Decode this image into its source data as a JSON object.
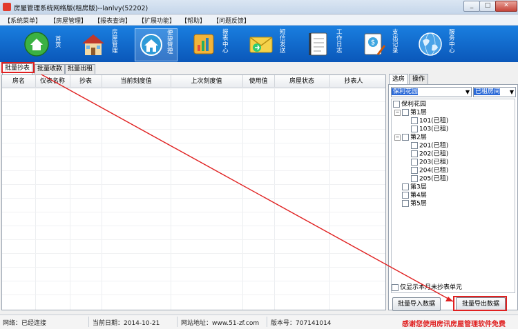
{
  "window": {
    "title": "房屋管理系统网络版(租房版)--lanlvy(52202)"
  },
  "menu": [
    "【系统菜单】",
    "【房屋管理】",
    "【报表查询】",
    "【扩展功能】",
    "【帮助】",
    "【问题反馈】"
  ],
  "toolbar": [
    {
      "label": "首页",
      "icon": "home-icon"
    },
    {
      "label": "房屋管理",
      "icon": "house-icon"
    },
    {
      "label": "便捷管理",
      "icon": "house-gear-icon"
    },
    {
      "label": "报表中心",
      "icon": "chart-book-icon"
    },
    {
      "label": "短信发送",
      "icon": "envelope-icon"
    },
    {
      "label": "工作日志",
      "icon": "notebook-icon"
    },
    {
      "label": "支出记录",
      "icon": "money-note-icon"
    },
    {
      "label": "服务中心",
      "icon": "globe-icon"
    }
  ],
  "tabs": [
    "批量抄表",
    "批量收款",
    "批量出租"
  ],
  "grid": {
    "columns": [
      "房名",
      "仪表名称",
      "抄表",
      "当前刻度值",
      "上次刻度值",
      "使用值",
      "房屋状态",
      "抄表人"
    ]
  },
  "right": {
    "tabs": [
      "选房",
      "操作"
    ],
    "community_select": "保利花园",
    "status_select": "已租房间",
    "tree": {
      "root": "保利花园",
      "floors": [
        {
          "name": "第1层",
          "rooms": [
            "101(已租)",
            "103(已租)"
          ]
        },
        {
          "name": "第2层",
          "rooms": [
            "201(已租)",
            "202(已租)",
            "203(已租)",
            "204(已租)",
            "205(已租)"
          ]
        },
        {
          "name": "第3层",
          "rooms": []
        },
        {
          "name": "第4层",
          "rooms": []
        },
        {
          "name": "第5层",
          "rooms": []
        }
      ]
    },
    "only_unread_label": "仅显示本月未抄表单元",
    "import_button": "批量导入数据",
    "export_button": "批量导出数据"
  },
  "status": {
    "network": "网络：已经连接",
    "date": "当前日期：2014-10-21",
    "website": "网站地址：www.51-zf.com",
    "version": "版本号：707141014",
    "thanks": "感谢您使用房讯房屋管理软件免费"
  },
  "colors": {
    "toolbar": "#0a63c7",
    "highlight": "#e02020"
  }
}
